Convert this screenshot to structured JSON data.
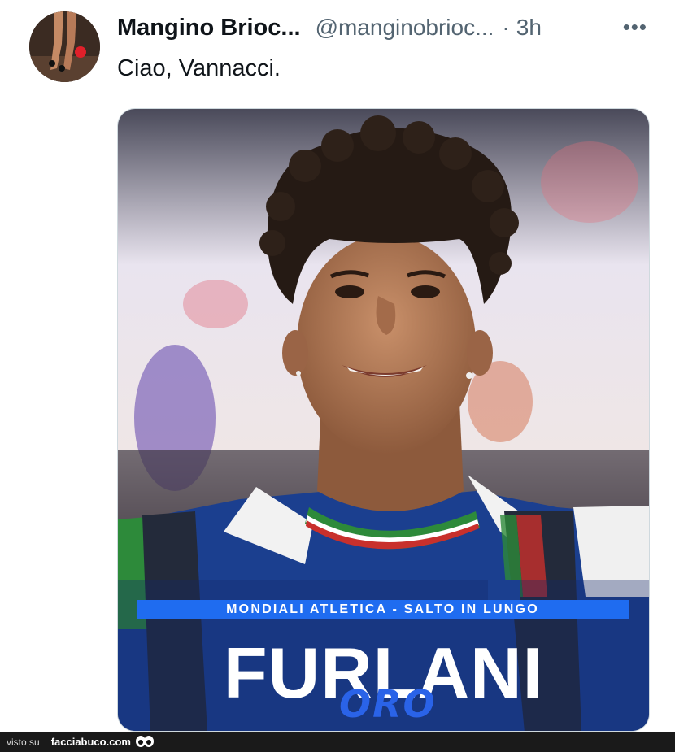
{
  "tweet": {
    "display_name": "Mangino Brioc...",
    "handle": "@manginobrioc...",
    "separator": "·",
    "time": "3h",
    "more_icon": "more-horizontal-icon",
    "more_label": "•••",
    "text": "Ciao, Vannacci."
  },
  "media": {
    "caption": "MONDIALI ATLETICA - SALTO IN LUNGO",
    "headline": "FURLANI",
    "subtitle": "ORO"
  },
  "footer": {
    "visto": "visto su",
    "site": "facciabuco.com"
  }
}
